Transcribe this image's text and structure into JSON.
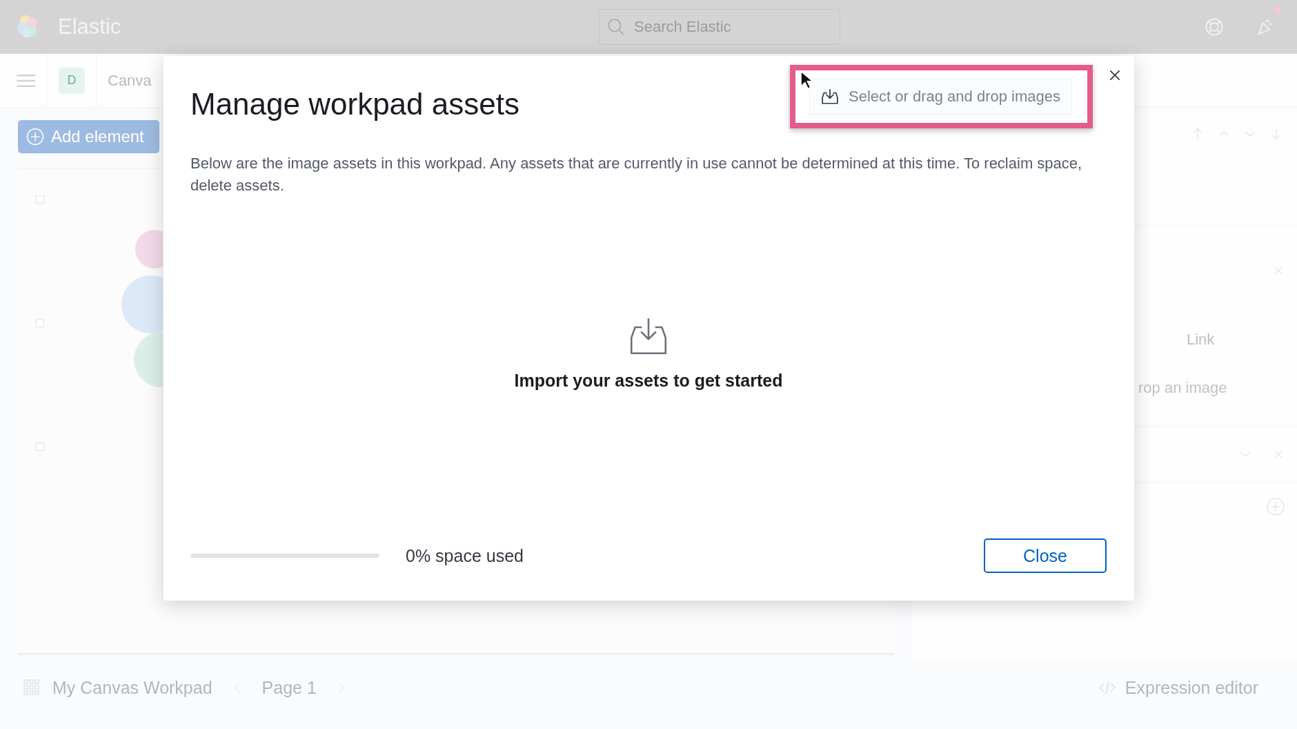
{
  "header": {
    "brand": "Elastic",
    "search": {
      "placeholder": "Search Elastic"
    },
    "has_notification": true
  },
  "toolbar": {
    "avatar": "D",
    "breadcrumb": "Canva"
  },
  "add_element": "Add element",
  "right_panel": {
    "link": "Link",
    "drop_hint": "rop an image"
  },
  "footer": {
    "workpad": "My Canvas Workpad",
    "page": "Page 1",
    "expression_editor": "Expression editor"
  },
  "dialog": {
    "title": "Manage workpad assets",
    "upload_button": {
      "label": "Select or drag and drop images",
      "highlighted": true
    },
    "description": "Below are the image assets in this workpad. Any assets that are currently in use cannot be determined at this time. To reclaim space, delete assets.",
    "empty_title": "Import your assets to get started",
    "usage": {
      "level": 0,
      "text": "0% space used"
    },
    "close_button": "Close"
  }
}
